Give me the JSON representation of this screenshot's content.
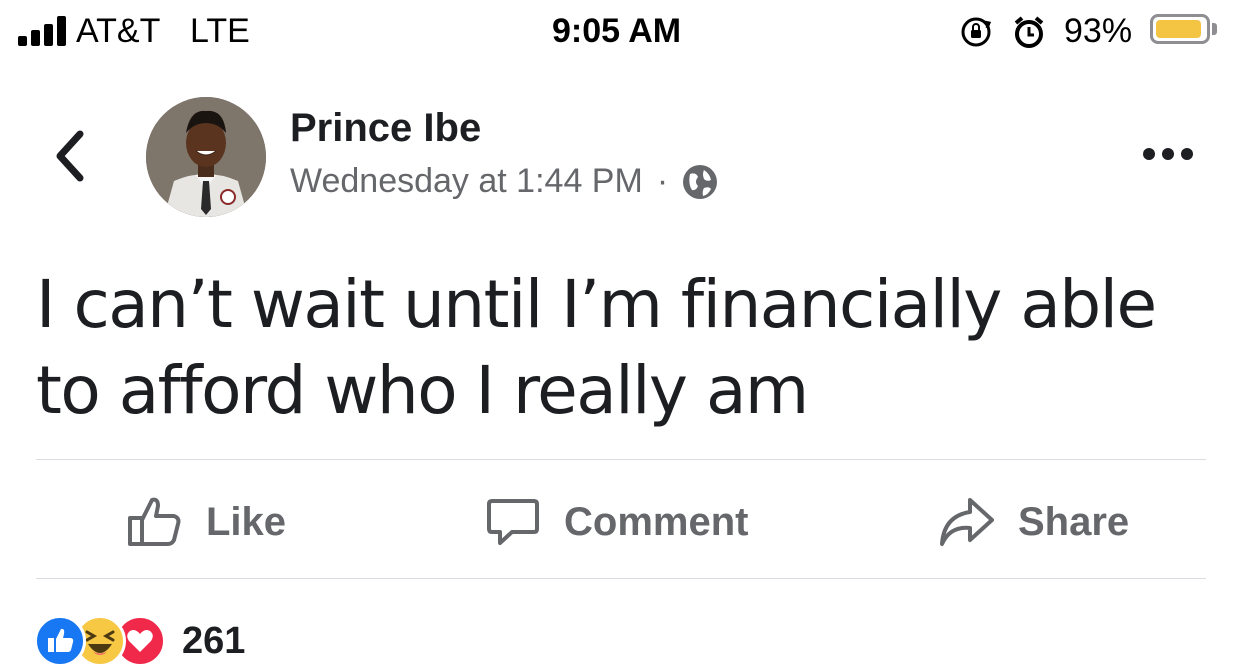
{
  "status_bar": {
    "carrier": "AT&T",
    "network": "LTE",
    "time": "9:05 AM",
    "battery_percent": "93%",
    "battery_level": 0.93,
    "icons": [
      "signal-bars-icon",
      "rotation-lock-icon",
      "alarm-icon",
      "battery-icon"
    ]
  },
  "post": {
    "author": "Prince Ibe",
    "timestamp": "Wednesday at 1:44 PM",
    "separator": "·",
    "privacy_icon": "globe-icon",
    "text": "I can’t wait until I’m financially able to afford who I really am"
  },
  "actions": {
    "like": "Like",
    "comment": "Comment",
    "share": "Share"
  },
  "reactions": {
    "types": [
      "like",
      "haha",
      "love"
    ],
    "count": "261"
  },
  "colors": {
    "like_blue": "#1877f2",
    "love_red": "#f0284a",
    "haha_yellow": "#f7c844",
    "muted_text": "#65676b",
    "battery_yellow": "#f4c542"
  }
}
